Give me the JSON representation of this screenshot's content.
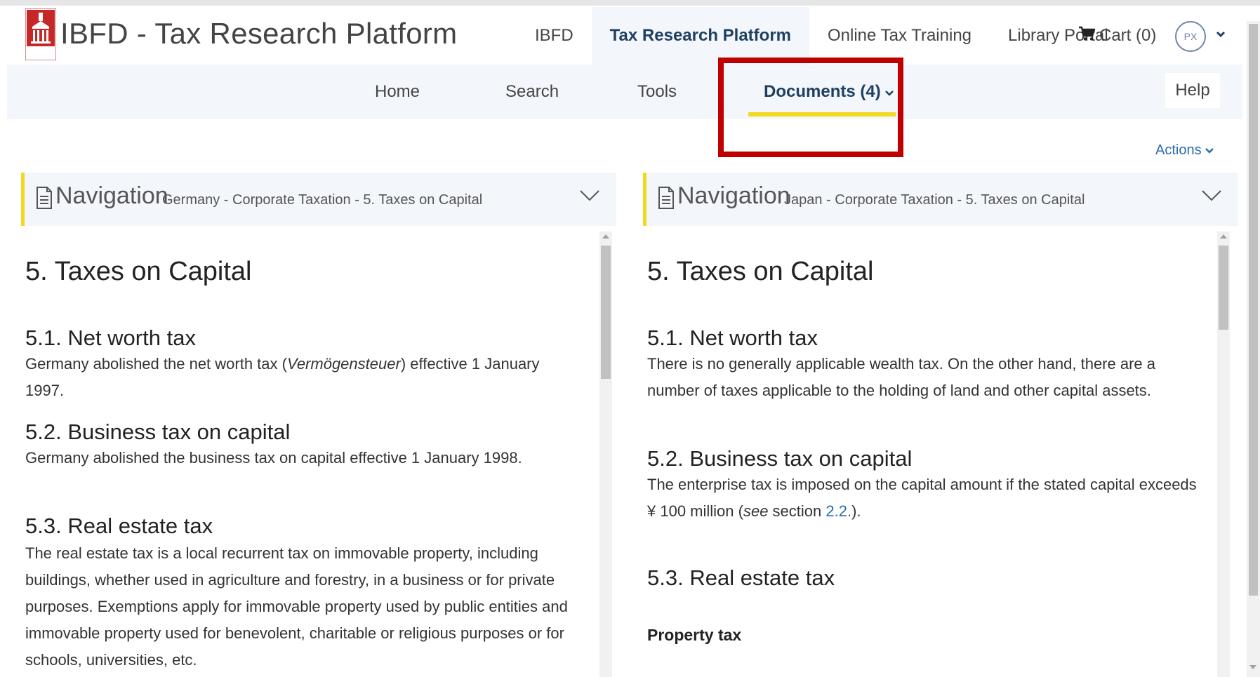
{
  "header": {
    "title": "IBFD - Tax Research Platform",
    "logo_text": "IBFD",
    "top_nav": [
      {
        "label": "IBFD"
      },
      {
        "label": "Tax Research Platform"
      },
      {
        "label": "Online Tax Training"
      },
      {
        "label": "Library Portal"
      }
    ],
    "cart_label": "Cart (0)",
    "avatar_initials": "PX"
  },
  "subnav": {
    "items": [
      {
        "label": "Home"
      },
      {
        "label": "Search"
      },
      {
        "label": "Tools"
      },
      {
        "label": "Documents (4)"
      }
    ],
    "active_index": 3,
    "help_label": "Help"
  },
  "actions_label": "Actions",
  "colors": {
    "accent_yellow": "#f2d91d",
    "highlight_red": "#c00000",
    "link_blue": "#2a6cac",
    "nav_bg": "#f3f6fa"
  },
  "left_pane": {
    "nav_label": "Navigation",
    "nav_path": "Germany - Corporate Taxation - 5. Taxes on Capital",
    "heading": "5. Taxes on Capital",
    "s1_title": "5.1. Net worth tax",
    "s1_pre": "Germany abolished the net worth tax (",
    "s1_italic": "Vermögensteuer",
    "s1_post": ") effective 1 January 1997.",
    "s2_title": "5.2. Business tax on capital",
    "s2_text": "Germany abolished the business tax on capital effective 1 January 1998.",
    "s3_title": "5.3. Real estate tax",
    "s3_text": "The real estate tax is a local recurrent tax on immovable property, including buildings, whether used in agriculture and forestry, in a business or for private purposes. Exemptions apply for immovable property used by public entities and immovable property used for benevolent, charitable or religious purposes or for schools, universities, etc."
  },
  "right_pane": {
    "nav_label": "Navigation",
    "nav_path": "Japan - Corporate Taxation - 5. Taxes on Capital",
    "heading": "5. Taxes on Capital",
    "s1_title": "5.1. Net worth tax",
    "s1_text": "There is no generally applicable wealth tax. On the other hand, there are a number of taxes applicable to the holding of land and other capital assets.",
    "s2_title": "5.2. Business tax on capital",
    "s2_text": "The enterprise tax is imposed on the capital amount if the stated capital exceeds ¥ 100 million (",
    "s2_see": "see",
    "s2_section": " section ",
    "s2_link": "2.2.",
    "s2_end": ").",
    "s3_title": "5.3. Real estate tax",
    "s3_sub": "Property tax"
  }
}
